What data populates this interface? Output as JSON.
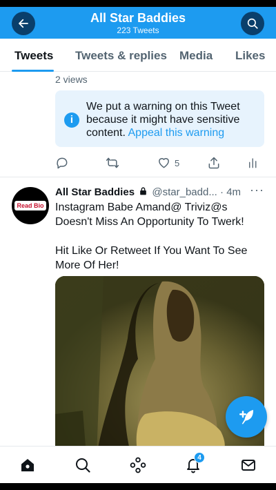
{
  "header": {
    "title": "All Star Baddies",
    "subtitle": "223 Tweets"
  },
  "tabs": [
    {
      "label": "Tweets",
      "active": true
    },
    {
      "label": "Tweets & replies",
      "active": false
    },
    {
      "label": "Media",
      "active": false
    },
    {
      "label": "Likes",
      "active": false
    }
  ],
  "prev_tweet": {
    "views": "2 views",
    "warning_text": "We put a warning on this Tweet because it might have sensitive content.",
    "appeal_link": "Appeal this warning",
    "like_count": "5"
  },
  "tweet": {
    "avatar_badge": "Read Bio",
    "author": "All Star Baddies",
    "handle": "@star_badd...",
    "separator": "·",
    "time": "4m",
    "more": "···",
    "text_lines": [
      "Instagram Babe Amand@ Triviz@s Doesn't Miss An Opportunity To Twerk!",
      "Hit Like Or Retweet If You Want To See More Of Her!"
    ]
  },
  "bottom_nav": {
    "notification_count": "4"
  },
  "colors": {
    "accent": "#1d9bf0",
    "header_button": "#0a3f6b",
    "warning_bg": "#e7f3fd"
  }
}
